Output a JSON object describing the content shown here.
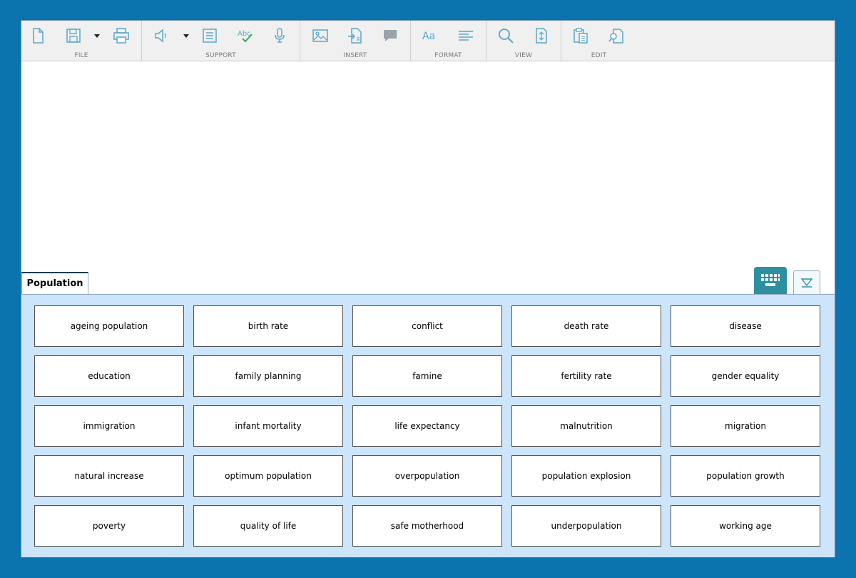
{
  "toolbar": {
    "groups": [
      {
        "label": "FILE",
        "icons": [
          "new-document-icon",
          "save-icon",
          "print-icon"
        ]
      },
      {
        "label": "SUPPORT",
        "icons": [
          "speaker-icon",
          "word-list-icon",
          "spell-check-icon",
          "microphone-icon"
        ]
      },
      {
        "label": "INSERT",
        "icons": [
          "image-icon",
          "insert-page-icon",
          "comment-icon"
        ]
      },
      {
        "label": "FORMAT",
        "icons": [
          "font-icon",
          "align-icon"
        ]
      },
      {
        "label": "VIEW",
        "icons": [
          "zoom-icon",
          "page-view-icon"
        ]
      },
      {
        "label": "EDIT",
        "icons": [
          "paste-icon",
          "find-replace-icon"
        ]
      }
    ],
    "font_icon_text": "Aa",
    "spell_icon_text": "Abc"
  },
  "wordbank": {
    "tab_label": "Population",
    "words": [
      "ageing population",
      "birth rate",
      "conflict",
      "death rate",
      "disease",
      "education",
      "family planning",
      "famine",
      "fertility rate",
      "gender equality",
      "immigration",
      "infant mortality",
      "life expectancy",
      "malnutrition",
      "migration",
      "natural increase",
      "optimum population",
      "overpopulation",
      "population explosion",
      "population growth",
      "poverty",
      "quality of life",
      "safe motherhood",
      "underpopulation",
      "working age"
    ]
  },
  "colors": {
    "accent": "#2e8fa0",
    "background": "#0b73ad",
    "panel": "#cce5fb",
    "icon": "#5aa6c8"
  }
}
